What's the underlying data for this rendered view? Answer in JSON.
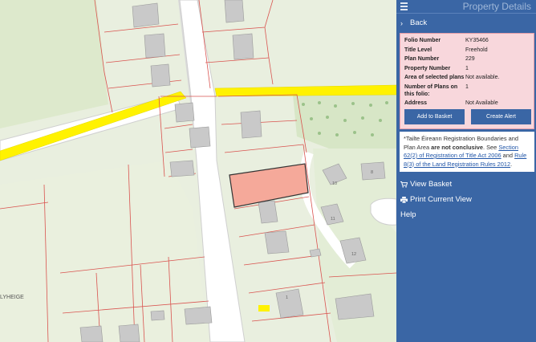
{
  "map": {
    "place_label": "LYHEIGE",
    "house_numbers": [
      "8",
      "10",
      "11",
      "12",
      "1"
    ]
  },
  "panel": {
    "title": "Property Details",
    "back_label": "Back",
    "fields": [
      {
        "key": "Folio Number",
        "value": "KY35466"
      },
      {
        "key": "Title Level",
        "value": "Freehold"
      },
      {
        "key": "Plan Number",
        "value": "229"
      },
      {
        "key": "Property Number",
        "value": "1"
      },
      {
        "key": "Area of selected plans",
        "value": "Not available."
      },
      {
        "key": "Number of Plans on this folio:",
        "value": "1"
      },
      {
        "key": "Address",
        "value": "Not Available"
      }
    ],
    "add_to_basket_label": "Add to Basket",
    "create_alert_label": "Create Alert",
    "notice": {
      "part1": "*Tailte Éireann Registration Boundaries and Plan Area ",
      "bold": "are not conclusive",
      "part2": ". See ",
      "link1": "Section 62(2) of Registration of Title Act 2006",
      "part3": " and ",
      "link2": "Rule 8(3) of the Land Registration Rules 2012",
      "part4": "."
    },
    "view_basket_label": "View Basket",
    "print_label": "Print Current View",
    "help_label": "Help"
  },
  "colors": {
    "panel_bg": "#3a66a5",
    "details_bg": "#f8d7dc",
    "selected_plot": "#f5a99a",
    "road_yellow": "#fff200",
    "boundary_red": "#d9534f"
  }
}
